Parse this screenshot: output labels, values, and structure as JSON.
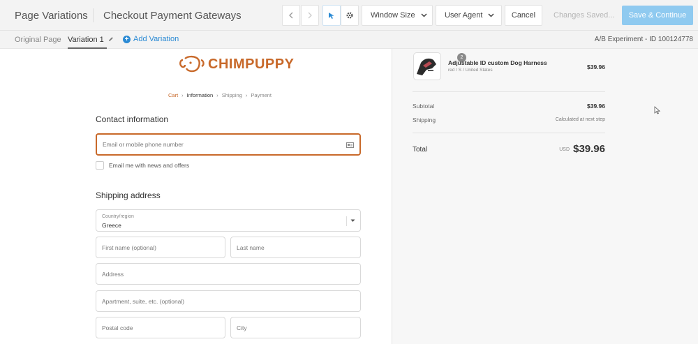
{
  "topbar": {
    "app_title": "Page Variations",
    "experiment_title": "Checkout Payment Gateways",
    "window_size_label": "Window Size",
    "user_agent_label": "User Agent",
    "cancel_label": "Cancel",
    "changes_label": "Changes Saved...",
    "save_label": "Save & Continue"
  },
  "tabs": {
    "original": "Original Page",
    "variation1": "Variation 1",
    "add_variation": "Add Variation",
    "experiment_id": "A/B Experiment - ID 100124778"
  },
  "store": {
    "logo_text": "CHIMPUPPY",
    "breadcrumb": [
      "Cart",
      "Information",
      "Shipping",
      "Payment"
    ],
    "contact_heading": "Contact information",
    "email_placeholder": "Email or mobile phone number",
    "newsletter_label": "Email me with news and offers",
    "shipping_heading": "Shipping address",
    "country_label": "Country/region",
    "country_value": "Greece",
    "first_name_placeholder": "First name (optional)",
    "last_name_placeholder": "Last name",
    "address_placeholder": "Address",
    "apartment_placeholder": "Apartment, suite, etc. (optional)",
    "postal_placeholder": "Postal code",
    "city_placeholder": "City"
  },
  "summary": {
    "quantity": "2",
    "product_name": "Adjustable ID custom Dog Harness",
    "product_variant": "red / S / United States",
    "product_price": "$39.96",
    "subtotal_label": "Subtotal",
    "subtotal_value": "$39.96",
    "shipping_label": "Shipping",
    "shipping_value": "Calculated at next step",
    "total_label": "Total",
    "total_currency": "USD",
    "total_value": "$39.96"
  },
  "colors": {
    "brand": "#c8692a",
    "accent": "#2a8ad4",
    "save_button": "#8fcaf0"
  }
}
